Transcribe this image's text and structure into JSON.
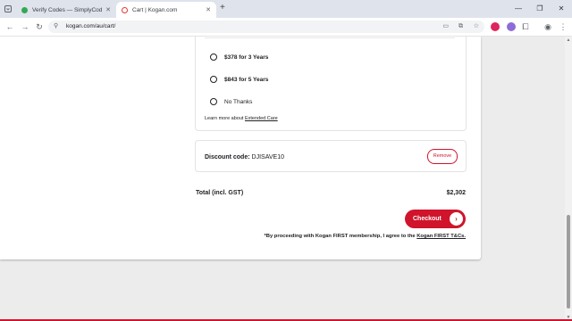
{
  "browser": {
    "tabs": [
      {
        "title": "Verify Codes — SimplyCodes",
        "active": false
      },
      {
        "title": "Cart | Kogan.com",
        "active": true
      }
    ],
    "url": "kogan.com/au/cart/"
  },
  "care": {
    "options": [
      {
        "label": "$378 for 3 Years"
      },
      {
        "label": "$843 for 5 Years"
      },
      {
        "label": "No Thanks"
      }
    ],
    "learn_prefix": "Learn more about",
    "learn_link": "Extended Care"
  },
  "discount": {
    "label": "Discount code",
    "code": "DJISAVE10",
    "remove": "Remove"
  },
  "total": {
    "label": "Total (incl. GST)",
    "value": "$2,302"
  },
  "checkout": {
    "label": "Checkout",
    "terms_prefix": "*By proceeding with Kogan FIRST membership, I agree to the",
    "terms_link": "Kogan FIRST T&Cs."
  },
  "colors": {
    "brand_red": "#d0142c",
    "tabstrip": "#dfe3ec"
  }
}
